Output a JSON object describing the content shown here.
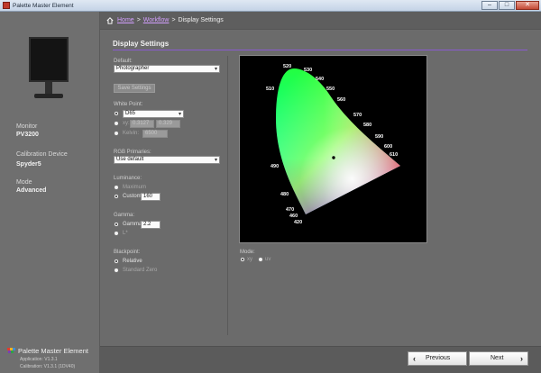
{
  "window": {
    "title": "Palette Master Element",
    "controls": {
      "minimize": "–",
      "maximize": "□",
      "close": "✕"
    }
  },
  "breadcrumb": {
    "home": "Home",
    "workflow": "Workflow",
    "separator": ">",
    "current": "Display Settings",
    "home_icon": "home-icon"
  },
  "sidebar": {
    "monitor_label": "Monitor",
    "monitor_value": "PV3200",
    "device_label": "Calibration Device",
    "device_value": "Spyder5",
    "mode_label": "Mode",
    "mode_value": "Advanced",
    "brand_name": "Palette Master Element",
    "application_version": "Application: V1.3.1",
    "calibration_version": "Calibration: V1.3.1 (1DV40)"
  },
  "settings": {
    "title": "Display Settings",
    "default_label": "Default:",
    "default_value": "Photographer",
    "save_button": "Save Settings",
    "white_point_label": "White Point:",
    "white_point_preset": "D65",
    "xy_option": "xy:",
    "xy_x": "0.3127",
    "xy_y": "0.329",
    "kelvin_option": "Kelvin:",
    "kelvin_value": "6500",
    "rgb_primaries_label": "RGB Primaries:",
    "rgb_primaries_value": "Use default",
    "luminance_label": "Luminance:",
    "luminance_max": "Maximum",
    "luminance_custom": "Custom:",
    "luminance_value": "160",
    "gamma_label": "Gamma:",
    "gamma_gamma": "Gamma:",
    "gamma_value": "2.2",
    "gamma_l": "L*",
    "blackpoint_label": "Blackpoint:",
    "blackpoint_relative": "Relative",
    "blackpoint_standard": "Standard Zero"
  },
  "gamut": {
    "mode_label": "Mode:",
    "mode_option_1": "xy",
    "mode_option_2": "uv",
    "wavelengths": [
      "520",
      "530",
      "540",
      "550",
      "560",
      "570",
      "580",
      "590",
      "600",
      "610",
      "510",
      "490",
      "480",
      "470",
      "460",
      "420"
    ]
  },
  "footer": {
    "previous": "Previous",
    "next": "Next"
  }
}
